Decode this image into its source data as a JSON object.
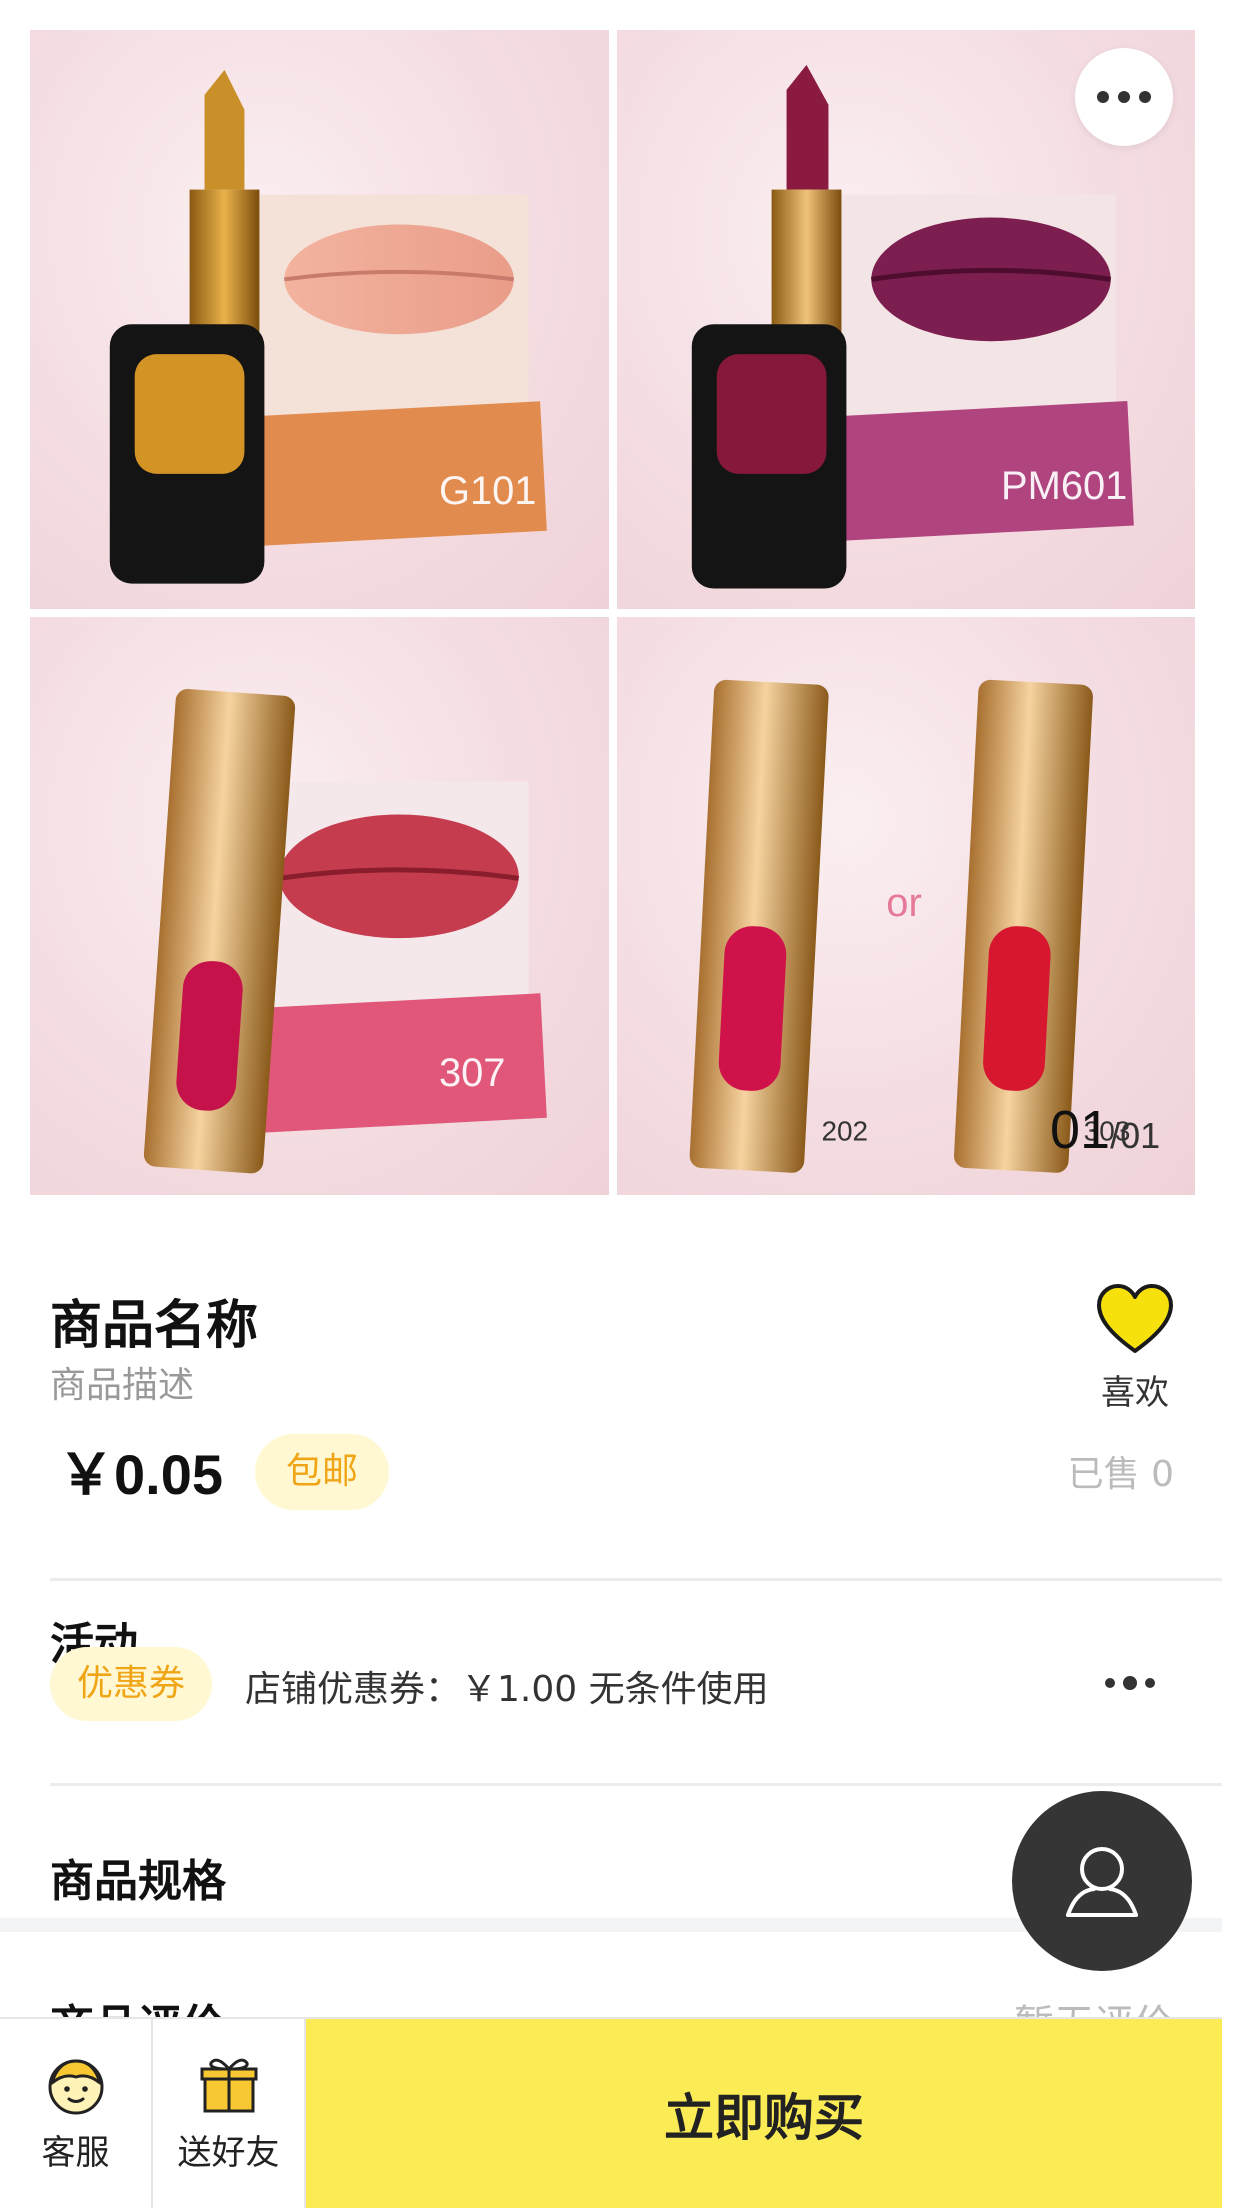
{
  "gallery": {
    "shades": [
      "G101",
      "PM601",
      "307"
    ],
    "pair_shades": [
      "202",
      "303"
    ],
    "pair_separator": "or",
    "page_current": "01",
    "page_total": "/01"
  },
  "product": {
    "name": "商品名称",
    "description": "商品描述",
    "price": "￥0.05",
    "shipping_badge": "包邮",
    "sold": "已售 0",
    "like_label": "喜欢"
  },
  "activity": {
    "title": "活动",
    "coupon_tag": "优惠券",
    "coupon_text": "店铺优惠券：￥1.00 无条件使用"
  },
  "specs": {
    "title": "商品规格"
  },
  "reviews": {
    "title": "商品评价",
    "empty_text": "暂无评价"
  },
  "bottom_bar": {
    "service_label": "客服",
    "gift_label": "送好友",
    "buy_label": "立即购买"
  },
  "colors": {
    "accent_yellow": "#fbeb55",
    "badge_bg": "#fff8d2",
    "badge_text": "#f0a516",
    "heart": "#f7e10c",
    "fab_bg": "#353535"
  },
  "icons": {
    "more": "more-dots-icon",
    "like": "heart-icon",
    "coupon_more": "ellipsis-icon",
    "chevron": "chevron-right-icon",
    "fab": "user-icon",
    "service": "service-face-icon",
    "gift": "gift-icon"
  }
}
